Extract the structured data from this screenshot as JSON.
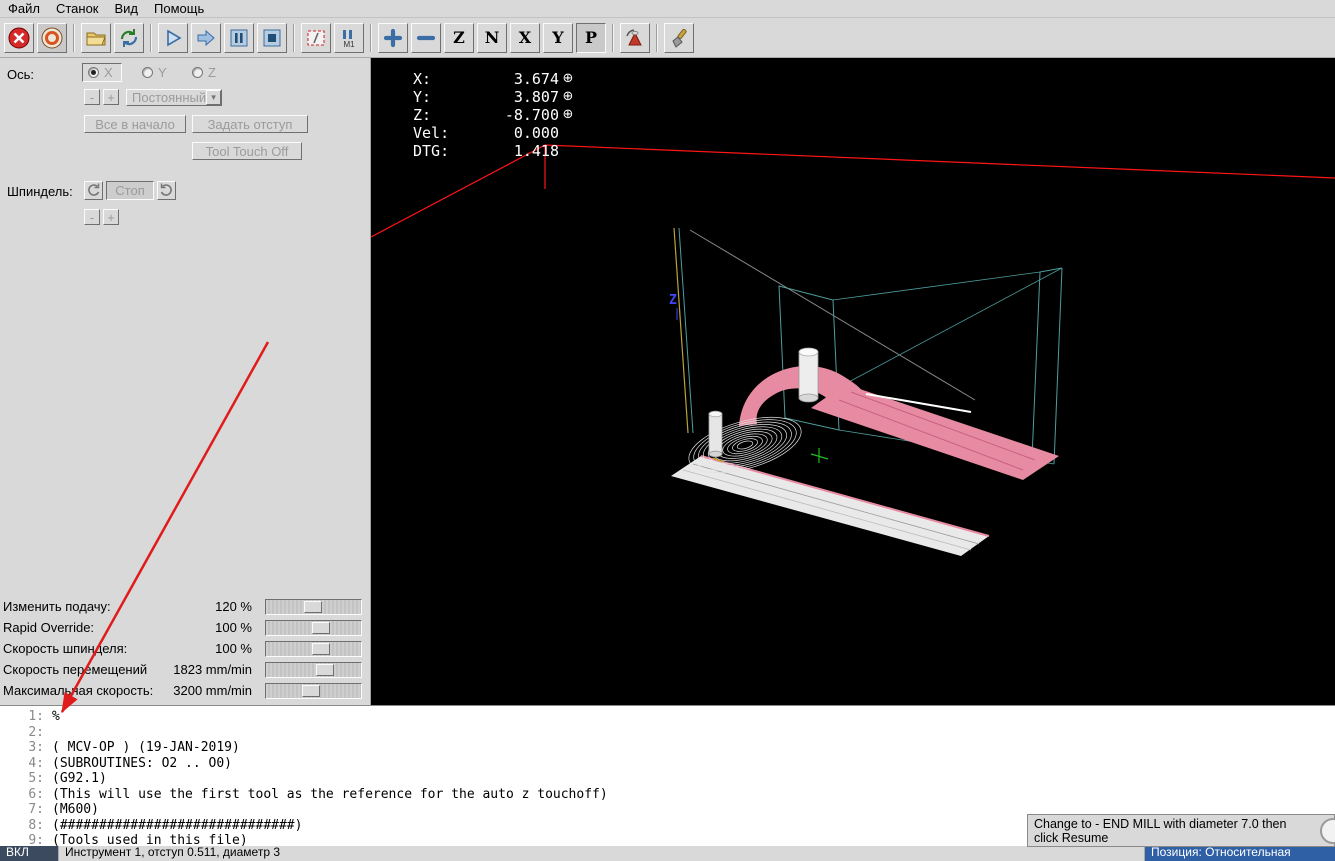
{
  "colors": {
    "panel_bg": "#d9d9d9",
    "view_bg": "#000000",
    "axis_red": "#ff1515",
    "toolpath_pink": "#e78ba2",
    "toolpath_teal": "#4f9e9e",
    "annotation_red": "#e01b1b",
    "dro_text": "#ffffff"
  },
  "menu": {
    "items": [
      {
        "label": "Файл"
      },
      {
        "label": "Станок"
      },
      {
        "label": "Вид"
      },
      {
        "label": "Помощь"
      }
    ]
  },
  "toolbar": {
    "view_letters": [
      "Z",
      "N",
      "X",
      "Y",
      "P"
    ],
    "optional_pause_label": "M1"
  },
  "jog": {
    "axis_label": "Ось:",
    "axes": [
      "X",
      "Y",
      "Z"
    ],
    "minus": "-",
    "plus": "+",
    "mode": "Постоянный",
    "home_all": "Все в начало",
    "touch_off": "Задать отступ",
    "tool_touch_off": "Tool Touch Off"
  },
  "spindle": {
    "label": "Шпиндель:",
    "stop": "Стоп",
    "minus": "-",
    "plus": "+"
  },
  "overrides": {
    "rows": [
      {
        "label": "Изменить подачу:",
        "value": "120 %"
      },
      {
        "label": "Rapid Override:",
        "value": "100 %"
      },
      {
        "label": "Скорость шпинделя:",
        "value": "100 %"
      },
      {
        "label": "Скорость перемещений",
        "value": "1823 mm/min"
      },
      {
        "label": "Максимальная скорость:",
        "value": "3200 mm/min"
      }
    ]
  },
  "dro": {
    "rows": [
      {
        "label": "X:",
        "value": "3.674"
      },
      {
        "label": "Y:",
        "value": "3.807"
      },
      {
        "label": "Z:",
        "value": "-8.700"
      },
      {
        "label": "Vel:",
        "value": "0.000"
      },
      {
        "label": "DTG:",
        "value": "1.418"
      }
    ]
  },
  "icons": {
    "homed": "⊕",
    "dropdown_arrow": "▼"
  },
  "scene": {
    "z_marker": "Z"
  },
  "gcode": {
    "lines": [
      {
        "num": "1:",
        "text": "%"
      },
      {
        "num": "2:",
        "text": ""
      },
      {
        "num": "3:",
        "text": "( MCV-OP ) (19-JAN-2019)"
      },
      {
        "num": "4:",
        "text": "(SUBROUTINES: O2 .. O0)"
      },
      {
        "num": "5:",
        "text": "(G92.1)"
      },
      {
        "num": "6:",
        "text": "(This will use the first tool as the reference for the auto z touchoff)"
      },
      {
        "num": "7:",
        "text": "(M600)"
      },
      {
        "num": "8:",
        "text": "(##############################)"
      },
      {
        "num": "9:",
        "text": "(Tools used in this file)"
      }
    ]
  },
  "popup": {
    "message": "Change to  - END MILL with diameter 7.0 then click Resume"
  },
  "statusbar": {
    "machine_state": "ВКЛ",
    "tool_info": "Инструмент 1, отступ 0.511, диаметр 3",
    "position_mode": "Позиция: Относительная"
  }
}
